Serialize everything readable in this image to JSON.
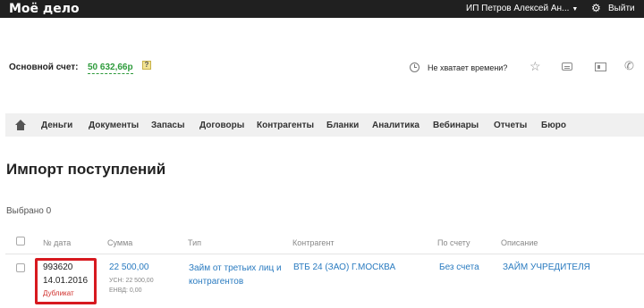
{
  "topbar": {
    "logo": "Моё дело",
    "user_name": "ИП Петров Алексей Ан...",
    "user_caret": "▼",
    "logout": "Выйти"
  },
  "account": {
    "label": "Основной счет:",
    "balance": "50 632,66р",
    "hint": "?"
  },
  "tools": {
    "no_time": "Не хватает времени?"
  },
  "nav": {
    "items": [
      "Деньги",
      "Документы",
      "Запасы",
      "Договоры",
      "Контрагенты",
      "Бланки",
      "Аналитика",
      "Вебинары",
      "Отчеты",
      "Бюро"
    ]
  },
  "page": {
    "title": "Импорт поступлений",
    "selected": "Выбрано 0"
  },
  "table": {
    "headers": [
      "№ дата",
      "Сумма",
      "Тип",
      "Контрагент",
      "По счету",
      "Описание"
    ],
    "rows": [
      {
        "number": "993620",
        "date": "14.01.2016",
        "badge": "Дубликат",
        "sum": "22 500,00",
        "usn": "УСН: 22 500,00",
        "envd": "ЕНВД: 0,00",
        "type_line1": "Займ от третьих лиц и",
        "type_line2": "контрагентов",
        "counterparty": "ВТБ 24 (ЗАО) Г.МОСКВА",
        "account": "Без счета",
        "description": "ЗАЙМ УЧРЕДИТЕЛЯ"
      }
    ]
  },
  "colors": {
    "topbar": "#202020",
    "balance": "#2e9b3c",
    "link": "#2a7bc0",
    "duplicate": "#d0312d",
    "highlight": "#d7191f"
  }
}
